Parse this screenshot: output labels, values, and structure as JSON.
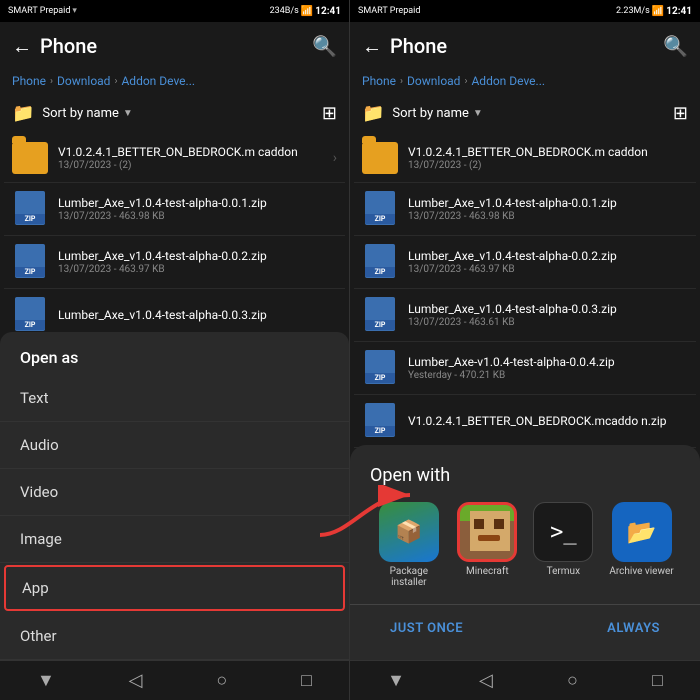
{
  "left_panel": {
    "status": {
      "carrier": "SMART Prepaid",
      "sub": "SMART",
      "speed": "234B/s",
      "time": "12:41"
    },
    "nav": {
      "title": "Phone",
      "back_label": "←",
      "search_label": "🔍"
    },
    "breadcrumb": {
      "items": [
        "Phone",
        "Download",
        "Addon Deve..."
      ]
    },
    "toolbar": {
      "sort_label": "Sort by name",
      "sort_chevron": "▼"
    },
    "files": [
      {
        "type": "folder",
        "name": "V1.0.2.4.1_BETTER_ON_BEDROCK.m caddon",
        "meta": "13/07/2023 - (2)"
      },
      {
        "type": "zip",
        "name": "Lumber_Axe_v1.0.4-test-alpha-0.0.1.zip",
        "meta": "13/07/2023 - 463.98 KB"
      },
      {
        "type": "zip",
        "name": "Lumber_Axe_v1.0.4-test-alpha-0.0.2.zip",
        "meta": "13/07/2023 - 463.97 KB"
      },
      {
        "type": "zip",
        "name": "Lumber_Axe_v1.0.4-test-alpha-0.0.3.zip",
        "meta": ""
      }
    ],
    "modal": {
      "title": "Open as",
      "items": [
        "Text",
        "Audio",
        "Video",
        "Image",
        "App",
        "Other"
      ],
      "highlighted": "App"
    }
  },
  "right_panel": {
    "status": {
      "carrier": "SMART Prepaid",
      "sub": "SMART",
      "speed": "2.23M/s",
      "time": "12:41"
    },
    "nav": {
      "title": "Phone",
      "back_label": "←",
      "search_label": "🔍"
    },
    "breadcrumb": {
      "items": [
        "Phone",
        "Download",
        "Addon Deve..."
      ]
    },
    "toolbar": {
      "sort_label": "Sort by name",
      "sort_chevron": "▼"
    },
    "files": [
      {
        "type": "folder",
        "name": "V1.0.2.4.1_BETTER_ON_BEDROCK.m caddon",
        "meta": "13/07/2023 - (2)"
      },
      {
        "type": "zip",
        "name": "Lumber_Axe_v1.0.4-test-alpha-0.0.1.zip",
        "meta": "13/07/2023 - 463.98 KB"
      },
      {
        "type": "zip",
        "name": "Lumber_Axe_v1.0.4-test-alpha-0.0.2.zip",
        "meta": "13/07/2023 - 463.97 KB"
      },
      {
        "type": "zip",
        "name": "Lumber_Axe_v1.0.4-test-alpha-0.0.3.zip",
        "meta": "13/07/2023 - 463.61 KB"
      },
      {
        "type": "zip",
        "name": "Lumber_Axe-v1.0.4-test-alpha-0.0.4.zip",
        "meta": "Yesterday - 470.21 KB"
      },
      {
        "type": "zip",
        "name": "V1.0.2.4.1_BETTER_ON_BEDROCK.mcaddo n.zip",
        "meta": ""
      }
    ],
    "open_with": {
      "title": "Open with",
      "apps": [
        {
          "name": "Package installer",
          "icon_type": "pkg"
        },
        {
          "name": "Minecraft",
          "icon_type": "minecraft"
        },
        {
          "name": "Termux",
          "icon_type": "termux"
        },
        {
          "name": "Archive viewer",
          "icon_type": "archive"
        }
      ],
      "buttons": [
        "JUST ONCE",
        "ALWAYS"
      ]
    }
  },
  "bottom_nav": {
    "items": [
      "▼",
      "◁",
      "○",
      "□"
    ]
  }
}
